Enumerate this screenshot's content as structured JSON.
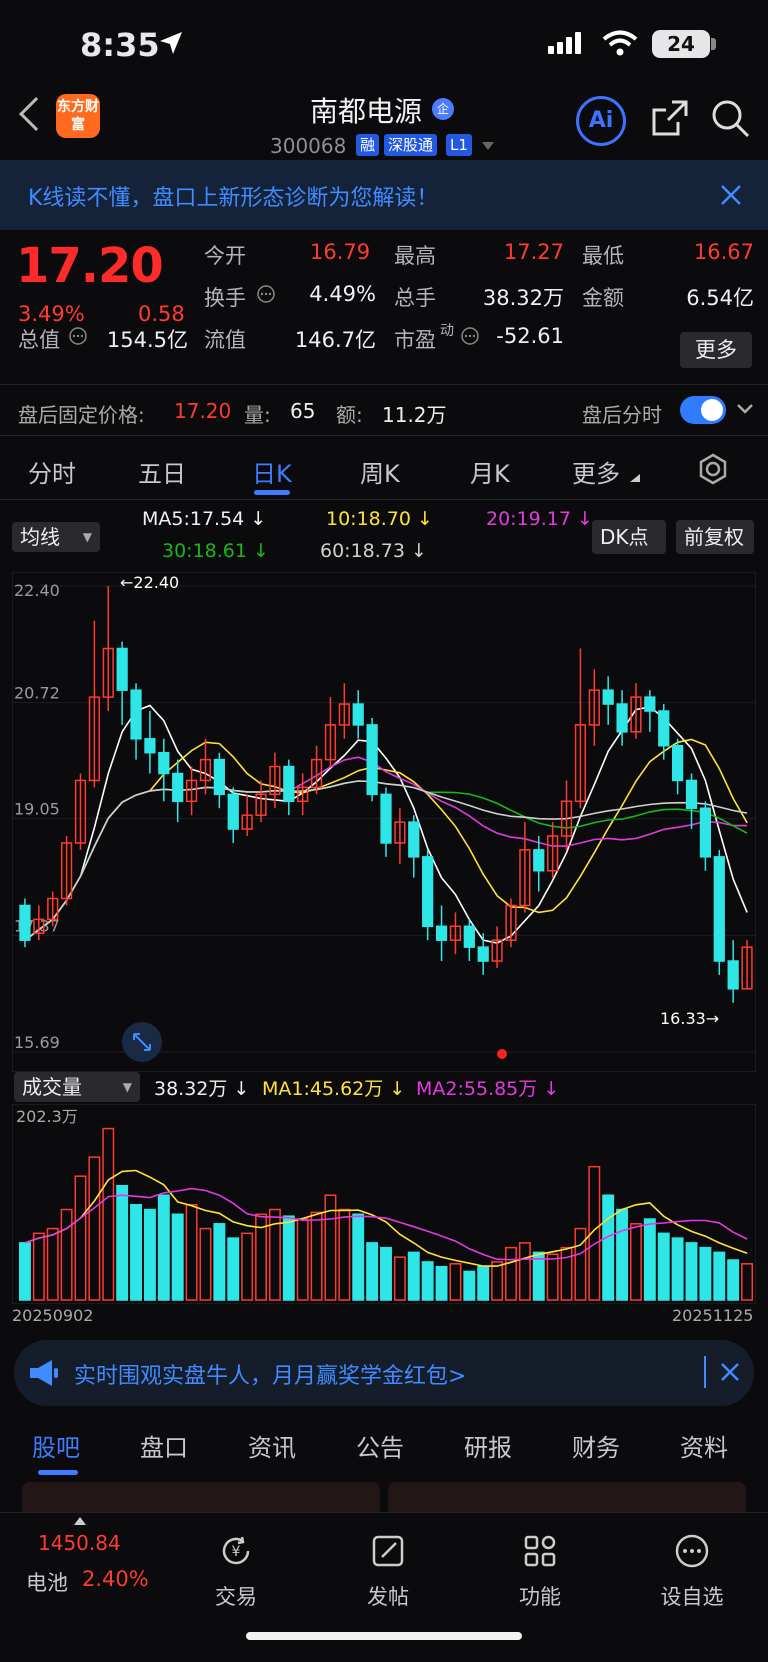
{
  "status_bar": {
    "time": "8:35",
    "battery": "24"
  },
  "header": {
    "logo": "东方财富",
    "stock_name": "南都电源",
    "badge": "企",
    "code": "300068",
    "tags": [
      "融",
      "深股通",
      "L1"
    ],
    "ai": "Ai"
  },
  "banner": {
    "text": "K线读不懂，盘口上新形态诊断为您解读！"
  },
  "quote": {
    "price": "17.20",
    "change_pct": "3.49%",
    "change": "0.58",
    "rows": [
      [
        {
          "label": "今开",
          "value": "16.79"
        },
        {
          "label": "最高",
          "value": "17.27"
        },
        {
          "label": "最低",
          "value": "16.67"
        }
      ],
      [
        {
          "label": "换手",
          "value": "4.49%"
        },
        {
          "label": "总手",
          "value": "38.32万"
        },
        {
          "label": "金额",
          "value": "6.54亿"
        }
      ]
    ],
    "total_value_label": "总值",
    "total_value": "154.5亿",
    "float_value_label": "流值",
    "float_value": "146.7亿",
    "pe_label": "市盈",
    "pe_sup": "动",
    "pe_value": "-52.61",
    "more": "更多"
  },
  "after_hours": {
    "label": "盘后固定价格:",
    "price": "17.20",
    "vol_label": "量:",
    "vol": "65",
    "amt_label": "额:",
    "amt": "11.2万",
    "toggle_label": "盘后分时"
  },
  "period_tabs": [
    "分时",
    "五日",
    "日K",
    "周K",
    "月K",
    "更多"
  ],
  "ma_row": {
    "selector": "均线",
    "ma5": "MA5:17.54",
    "ma10": "10:18.70",
    "ma20": "20:19.17",
    "ma30": "30:18.61",
    "ma60": "60:18.73",
    "dk": "DK点",
    "adjust": "前复权",
    "arrow": "↓"
  },
  "vol_row": {
    "selector": "成交量",
    "vol": "38.32万",
    "ma1": "MA1:45.62万",
    "ma2": "MA2:55.85万",
    "arrow": "↓"
  },
  "colors": {
    "up": "#ff3b30",
    "down": "#2ee6e6",
    "ma5": "#ffffff",
    "ma10": "#ffe23a",
    "ma20": "#e23ae0",
    "ma30": "#18b818",
    "ma60": "#cfcfcf",
    "accent": "#3d7bff"
  },
  "chart_data": {
    "type": "candlestick",
    "y_ticks": [
      "22.40",
      "20.72",
      "19.05",
      "17.37",
      "15.69"
    ],
    "ylim": [
      15.69,
      22.4
    ],
    "max_label": "←22.40",
    "min_label": "16.33→",
    "x_start": "20250902",
    "x_end": "20251125",
    "vol_max_label": "202.3万",
    "candles": [
      [
        17.8,
        17.3,
        17.9,
        17.2
      ],
      [
        17.4,
        17.6,
        17.8,
        17.3
      ],
      [
        17.6,
        17.9,
        18.0,
        17.5
      ],
      [
        17.9,
        18.7,
        18.8,
        17.8
      ],
      [
        18.7,
        19.6,
        19.7,
        18.6
      ],
      [
        19.6,
        20.8,
        21.9,
        19.5
      ],
      [
        20.8,
        21.5,
        22.4,
        20.6
      ],
      [
        21.5,
        20.9,
        21.6,
        20.4
      ],
      [
        20.9,
        20.2,
        21.0,
        19.9
      ],
      [
        20.2,
        20.0,
        20.6,
        19.7
      ],
      [
        20.0,
        19.7,
        20.2,
        19.3
      ],
      [
        19.7,
        19.3,
        19.9,
        19.0
      ],
      [
        19.3,
        19.6,
        19.8,
        19.1
      ],
      [
        19.6,
        19.9,
        20.2,
        19.4
      ],
      [
        19.9,
        19.4,
        20.0,
        19.2
      ],
      [
        19.4,
        18.9,
        19.5,
        18.7
      ],
      [
        18.9,
        19.1,
        19.4,
        18.8
      ],
      [
        19.1,
        19.4,
        19.6,
        19.0
      ],
      [
        19.4,
        19.8,
        20.0,
        19.2
      ],
      [
        19.8,
        19.3,
        19.9,
        19.1
      ],
      [
        19.3,
        19.5,
        19.7,
        19.1
      ],
      [
        19.5,
        19.9,
        20.1,
        19.4
      ],
      [
        19.9,
        20.4,
        20.8,
        19.8
      ],
      [
        20.4,
        20.7,
        21.0,
        20.2
      ],
      [
        20.7,
        20.4,
        20.9,
        20.2
      ],
      [
        20.4,
        19.4,
        20.5,
        19.3
      ],
      [
        19.4,
        18.7,
        19.5,
        18.5
      ],
      [
        18.7,
        19.0,
        19.2,
        18.4
      ],
      [
        19.0,
        18.5,
        19.1,
        18.2
      ],
      [
        18.5,
        17.5,
        18.6,
        17.3
      ],
      [
        17.5,
        17.3,
        17.8,
        17.0
      ],
      [
        17.3,
        17.5,
        17.7,
        17.1
      ],
      [
        17.5,
        17.2,
        17.6,
        17.0
      ],
      [
        17.2,
        17.0,
        17.4,
        16.8
      ],
      [
        17.0,
        17.3,
        17.5,
        16.9
      ],
      [
        17.3,
        17.8,
        17.9,
        17.2
      ],
      [
        17.8,
        18.6,
        19.0,
        17.7
      ],
      [
        18.6,
        18.3,
        18.8,
        18.0
      ],
      [
        18.3,
        18.8,
        19.0,
        18.2
      ],
      [
        18.8,
        19.3,
        19.6,
        18.6
      ],
      [
        19.3,
        20.4,
        21.5,
        19.2
      ],
      [
        20.4,
        20.9,
        21.2,
        20.1
      ],
      [
        20.9,
        20.7,
        21.1,
        20.4
      ],
      [
        20.7,
        20.3,
        20.9,
        20.1
      ],
      [
        20.3,
        20.8,
        21.0,
        20.2
      ],
      [
        20.8,
        20.6,
        20.9,
        20.3
      ],
      [
        20.6,
        20.1,
        20.7,
        19.9
      ],
      [
        20.1,
        19.6,
        20.2,
        19.4
      ],
      [
        19.6,
        19.2,
        19.7,
        18.9
      ],
      [
        19.2,
        18.5,
        19.3,
        18.3
      ],
      [
        18.5,
        17.0,
        18.6,
        16.8
      ],
      [
        17.0,
        16.6,
        17.3,
        16.4
      ],
      [
        16.6,
        17.2,
        17.3,
        16.6
      ]
    ],
    "volumes": [
      60,
      70,
      75,
      95,
      130,
      150,
      180,
      120,
      100,
      95,
      110,
      90,
      100,
      75,
      80,
      65,
      70,
      90,
      95,
      88,
      85,
      92,
      110,
      95,
      90,
      60,
      55,
      45,
      50,
      40,
      35,
      38,
      30,
      35,
      40,
      55,
      60,
      50,
      48,
      55,
      75,
      140,
      110,
      95,
      80,
      85,
      70,
      65,
      60,
      55,
      50,
      42,
      38
    ]
  },
  "promo": {
    "text": "实时围观实盘牛人，月月赢奖学金红包>"
  },
  "bottom_tabs": [
    "股吧",
    "盘口",
    "资讯",
    "公告",
    "研报",
    "财务",
    "资料"
  ],
  "bottom_nav": {
    "index_value": "1450.84",
    "index_name": "电池",
    "index_change": "2.40%",
    "items": [
      {
        "label": "交易",
        "icon": "yuan-icon"
      },
      {
        "label": "发帖",
        "icon": "edit-icon"
      },
      {
        "label": "功能",
        "icon": "grid-icon"
      },
      {
        "label": "设自选",
        "icon": "more-icon"
      }
    ]
  }
}
